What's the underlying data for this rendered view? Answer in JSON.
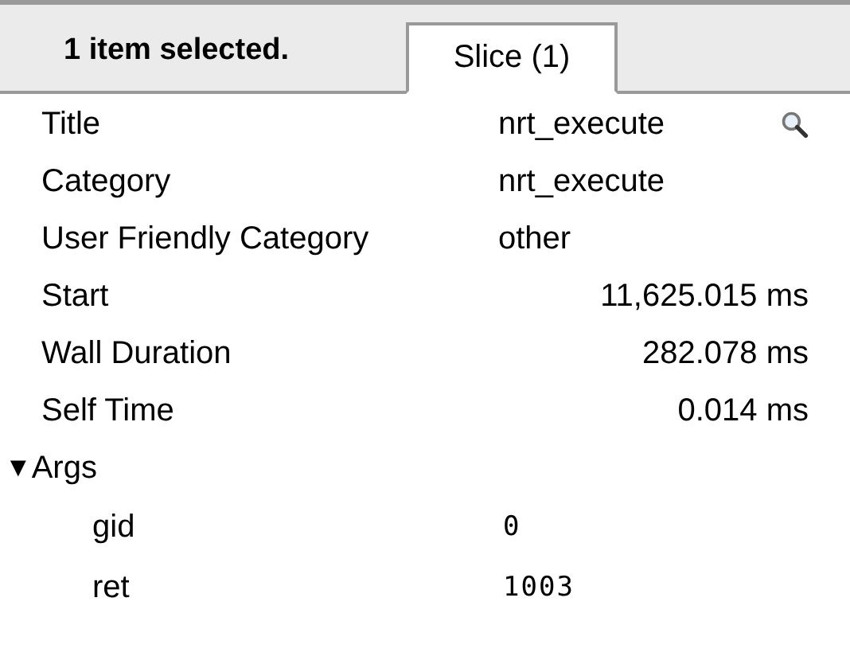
{
  "header": {
    "summary": "1 item selected.",
    "tabs": [
      {
        "label": "Slice (1)",
        "selected": true
      }
    ]
  },
  "properties": [
    {
      "label": "Title",
      "value": "nrt_execute",
      "kind": "text",
      "searchable": true
    },
    {
      "label": "Category",
      "value": "nrt_execute",
      "kind": "text",
      "searchable": false
    },
    {
      "label": "User Friendly Category",
      "value": "other",
      "kind": "text",
      "searchable": false
    },
    {
      "label": "Start",
      "value": "11,625.015 ms",
      "kind": "number",
      "searchable": false
    },
    {
      "label": "Wall Duration",
      "value": "282.078 ms",
      "kind": "number",
      "searchable": false
    },
    {
      "label": "Self Time",
      "value": "0.014 ms",
      "kind": "number",
      "searchable": false
    }
  ],
  "args": {
    "toggle": "▼",
    "label": "Args",
    "expanded": true,
    "children": [
      {
        "label": "gid",
        "value": "0"
      },
      {
        "label": "ret",
        "value": "1003"
      }
    ]
  }
}
